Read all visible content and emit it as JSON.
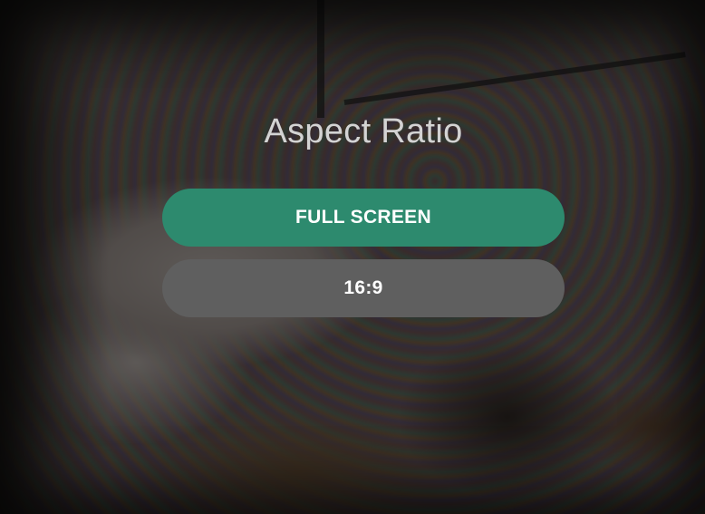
{
  "dialog": {
    "title": "Aspect Ratio",
    "options": [
      {
        "label": "FULL SCREEN",
        "selected": true,
        "color": "#2d8a6e"
      },
      {
        "label": "16:9",
        "selected": false,
        "color": "#5f5f5f"
      }
    ]
  },
  "colors": {
    "accent": "#2d8a6e",
    "unselected": "#5f5f5f",
    "title_text": "#d3d3d3"
  }
}
